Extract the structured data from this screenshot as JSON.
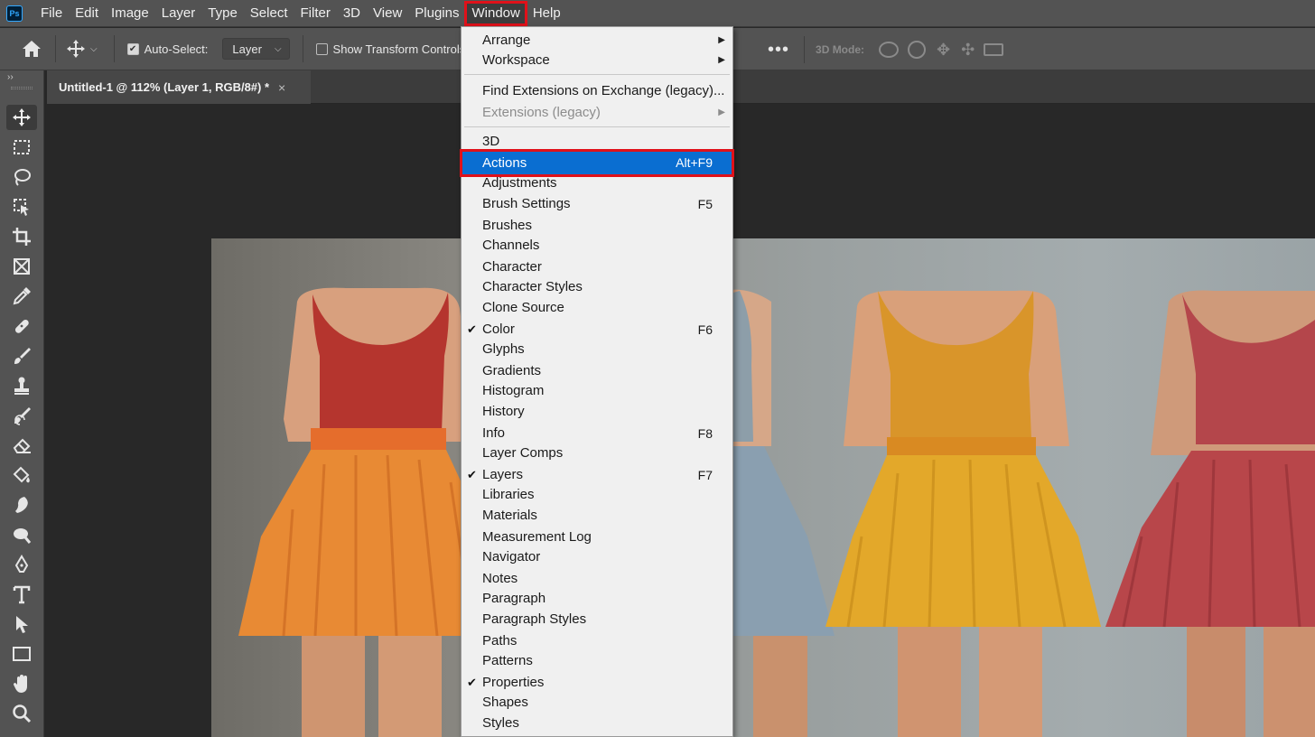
{
  "app": {
    "logo_text": "Ps"
  },
  "menubar": {
    "items": [
      "File",
      "Edit",
      "Image",
      "Layer",
      "Type",
      "Select",
      "Filter",
      "3D",
      "View",
      "Plugins",
      "Window",
      "Help"
    ],
    "active": "Window"
  },
  "options": {
    "auto_select_label": "Auto-Select:",
    "auto_select_checked": true,
    "auto_select_target": "Layer",
    "show_transform_label": "Show Transform Controls",
    "show_transform_checked": false,
    "three_d_mode_label": "3D Mode:"
  },
  "document": {
    "tab_title": "Untitled-1 @ 112% (Layer 1, RGB/8#) *",
    "close_glyph": "×"
  },
  "toolbar": {
    "collapse_glyph": "››",
    "tools": [
      "move-tool",
      "marquee-tool",
      "lasso-tool",
      "object-selection-tool",
      "crop-tool",
      "frame-tool",
      "eyedropper-tool",
      "healing-brush-tool",
      "brush-tool",
      "clone-stamp-tool",
      "history-brush-tool",
      "eraser-tool",
      "paint-bucket-tool",
      "blur-tool",
      "dodge-tool",
      "pen-tool",
      "type-tool",
      "path-selection-tool",
      "rectangle-tool",
      "hand-tool",
      "zoom-tool",
      "more-tools"
    ],
    "selected": "move-tool"
  },
  "window_menu": {
    "groups": [
      [
        {
          "label": "Arrange",
          "submenu": true
        },
        {
          "label": "Workspace",
          "submenu": true
        }
      ],
      [
        {
          "label": "Find Extensions on Exchange (legacy)..."
        },
        {
          "label": "Extensions (legacy)",
          "submenu": true,
          "disabled": true
        }
      ],
      [
        {
          "label": "3D"
        },
        {
          "label": "Actions",
          "shortcut": "Alt+F9",
          "highlighted": true
        },
        {
          "label": "Adjustments"
        },
        {
          "label": "Brush Settings",
          "shortcut": "F5"
        },
        {
          "label": "Brushes"
        },
        {
          "label": "Channels"
        },
        {
          "label": "Character"
        },
        {
          "label": "Character Styles"
        },
        {
          "label": "Clone Source"
        },
        {
          "label": "Color",
          "shortcut": "F6",
          "checked": true
        },
        {
          "label": "Glyphs"
        },
        {
          "label": "Gradients"
        },
        {
          "label": "Histogram"
        },
        {
          "label": "History"
        },
        {
          "label": "Info",
          "shortcut": "F8"
        },
        {
          "label": "Layer Comps"
        },
        {
          "label": "Layers",
          "shortcut": "F7",
          "checked": true
        },
        {
          "label": "Libraries"
        },
        {
          "label": "Materials"
        },
        {
          "label": "Measurement Log"
        },
        {
          "label": "Navigator"
        },
        {
          "label": "Notes"
        },
        {
          "label": "Paragraph"
        },
        {
          "label": "Paragraph Styles"
        },
        {
          "label": "Paths"
        },
        {
          "label": "Patterns"
        },
        {
          "label": "Properties",
          "checked": true
        },
        {
          "label": "Shapes"
        },
        {
          "label": "Styles"
        }
      ]
    ],
    "submenu_glyph": "▶",
    "check_glyph": "✔"
  },
  "canvas": {
    "dress_colors": [
      "#e88a34",
      "#8a9fb0",
      "#e3a82a",
      "#b8464a"
    ],
    "bodice_colors": [
      "#b5352e",
      "#8d9ea9",
      "#d9952a",
      "#b4464b"
    ]
  },
  "colors": {
    "highlight": "#0a6ed1",
    "annotation": "#e0111a"
  }
}
